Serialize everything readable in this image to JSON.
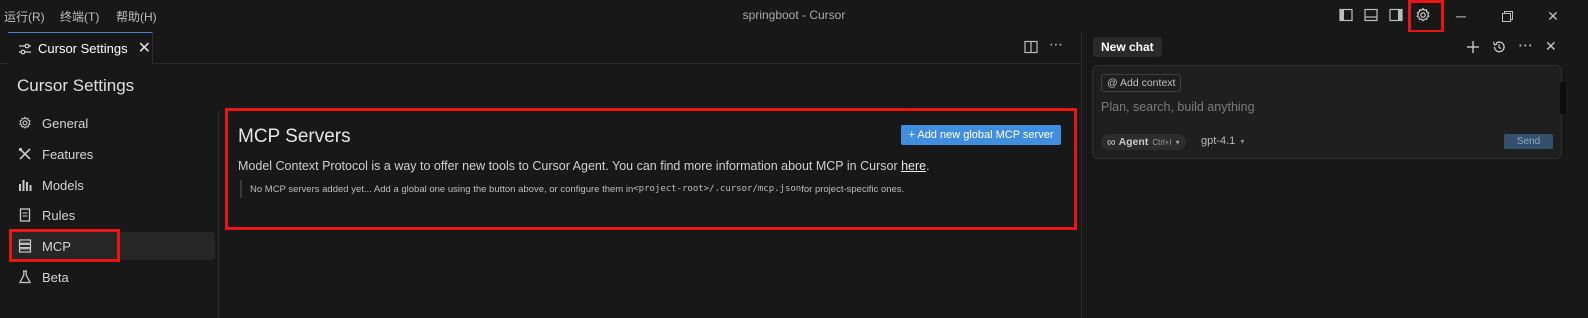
{
  "titlebar": {
    "menus": [
      "运行(R)",
      "终端(T)",
      "帮助(H)"
    ],
    "title": "springboot - Cursor",
    "window_controls": [
      "minimize",
      "restore",
      "close"
    ]
  },
  "editor": {
    "tab_label": "Cursor Settings",
    "tab_close": "✕",
    "actions": [
      "split-editor-icon",
      "more-icon"
    ]
  },
  "settings": {
    "page_title": "Cursor Settings",
    "nav": [
      {
        "label": "General",
        "icon": "gear-icon"
      },
      {
        "label": "Features",
        "icon": "tools-icon"
      },
      {
        "label": "Models",
        "icon": "bar-chart-icon"
      },
      {
        "label": "Rules",
        "icon": "document-icon"
      },
      {
        "label": "MCP",
        "icon": "server-icon",
        "active": true
      },
      {
        "label": "Beta",
        "icon": "flask-icon"
      }
    ]
  },
  "mcp": {
    "title": "MCP Servers",
    "add_button": "+ Add new global MCP server",
    "description_prefix": "Model Context Protocol is a way to offer new tools to Cursor Agent. You can find more information about MCP in Cursor ",
    "description_link": "here",
    "description_suffix": ".",
    "note_prefix": "No MCP servers added yet... Add a global one using the button above, or configure them in ",
    "note_code": "<project-root>/.cursor/mcp.json",
    "note_suffix": " for project-specific ones."
  },
  "chat": {
    "tab_label": "New chat",
    "add_context": "@ Add context",
    "placeholder": "Plan, search, build anything",
    "agent_label": "Agent",
    "agent_shortcut": "Ctrl+I",
    "model": "gpt-4.1",
    "send_label": "Send"
  },
  "colors": {
    "highlight": "#e81416",
    "accent": "#3f8fde",
    "background": "#181818"
  }
}
